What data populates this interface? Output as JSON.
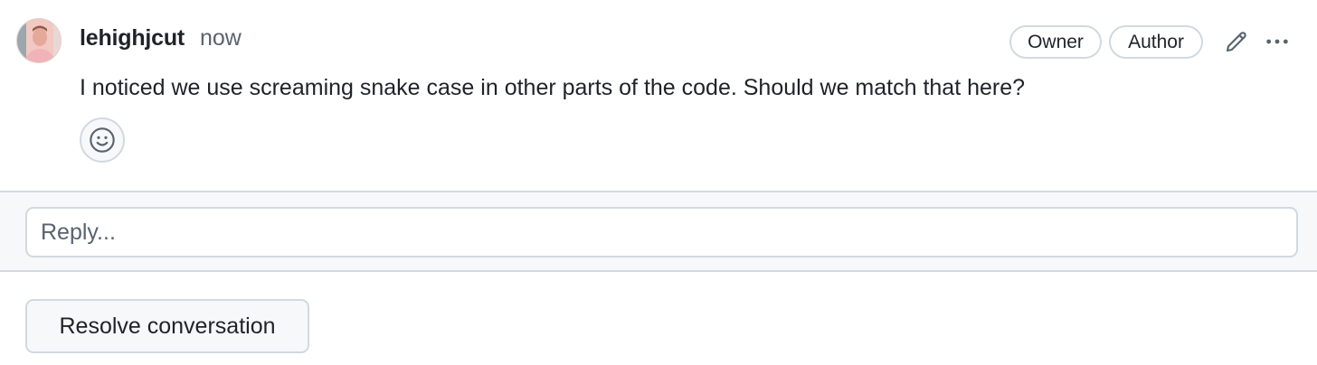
{
  "comment": {
    "author": "lehighjcut",
    "timestamp": "now",
    "badges": [
      "Owner",
      "Author"
    ],
    "body": "I noticed we use screaming snake case in other parts of the code. Should we match that here?",
    "icons": {
      "edit": "pencil-icon",
      "more": "kebab-horizontal-icon",
      "reaction": "smiley-icon"
    }
  },
  "reply": {
    "placeholder": "Reply..."
  },
  "actions": {
    "resolve_label": "Resolve conversation"
  },
  "colors": {
    "text": "#1f2328",
    "muted": "#59636e",
    "border": "#d1d9e0",
    "panel_bg": "#f6f8fa"
  }
}
